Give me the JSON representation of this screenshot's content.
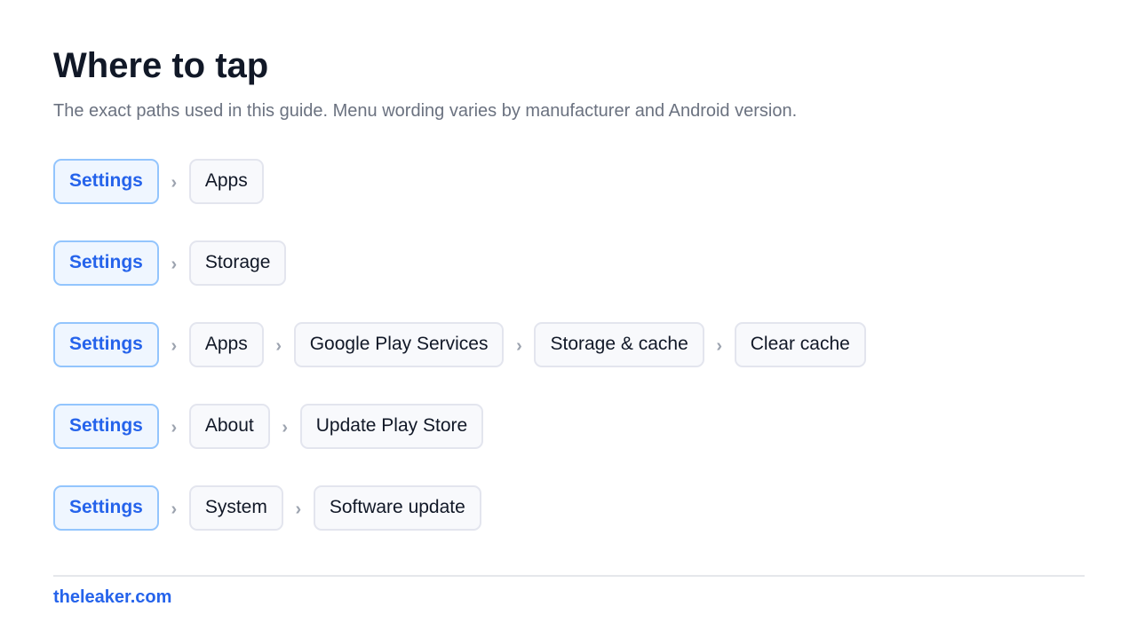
{
  "title": "Where to tap",
  "subtitle": "The exact paths used in this guide. Menu wording varies by manufacturer and Android version.",
  "separator": "›",
  "paths": [
    [
      "Settings",
      "Apps"
    ],
    [
      "Settings",
      "Storage"
    ],
    [
      "Settings",
      "Apps",
      "Google Play Services",
      "Storage & cache",
      "Clear cache"
    ],
    [
      "Settings",
      "About",
      "Update Play Store"
    ],
    [
      "Settings",
      "System",
      "Software update"
    ]
  ],
  "footer": {
    "site": "theleaker.com"
  },
  "colors": {
    "accent": "#2563eb",
    "chip_border": "#e3e5ee",
    "root_bg": "#eff6ff"
  }
}
